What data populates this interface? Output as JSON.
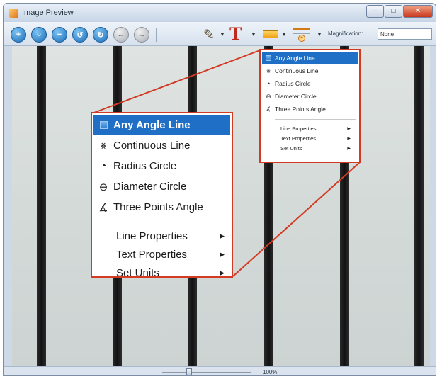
{
  "window": {
    "title": "Image Preview",
    "controls": {
      "minimize": "–",
      "maximize": "□",
      "close": "✕"
    }
  },
  "toolbar": {
    "magnification_label": "Magnification:",
    "magnification_value": "None",
    "text_tool_glyph": "T"
  },
  "status": {
    "zoom": "100%"
  },
  "measure_menu": {
    "items": [
      {
        "label": "Any Angle Line",
        "icon": "any-angle-line-icon",
        "highlighted": true
      },
      {
        "label": "Continuous Line",
        "icon": "continuous-line-icon"
      },
      {
        "label": "Radius Circle",
        "icon": "radius-circle-icon"
      },
      {
        "label": "Diameter Circle",
        "icon": "diameter-circle-icon"
      },
      {
        "label": "Three Points Angle",
        "icon": "three-points-angle-icon"
      }
    ],
    "submenus": [
      {
        "label": "Line Properties"
      },
      {
        "label": "Text Properties"
      },
      {
        "label": "Set Units"
      }
    ]
  },
  "colors": {
    "highlight": "#1f6fc7",
    "callout_border": "#d23a23",
    "stripe": "#1a1a1a"
  }
}
